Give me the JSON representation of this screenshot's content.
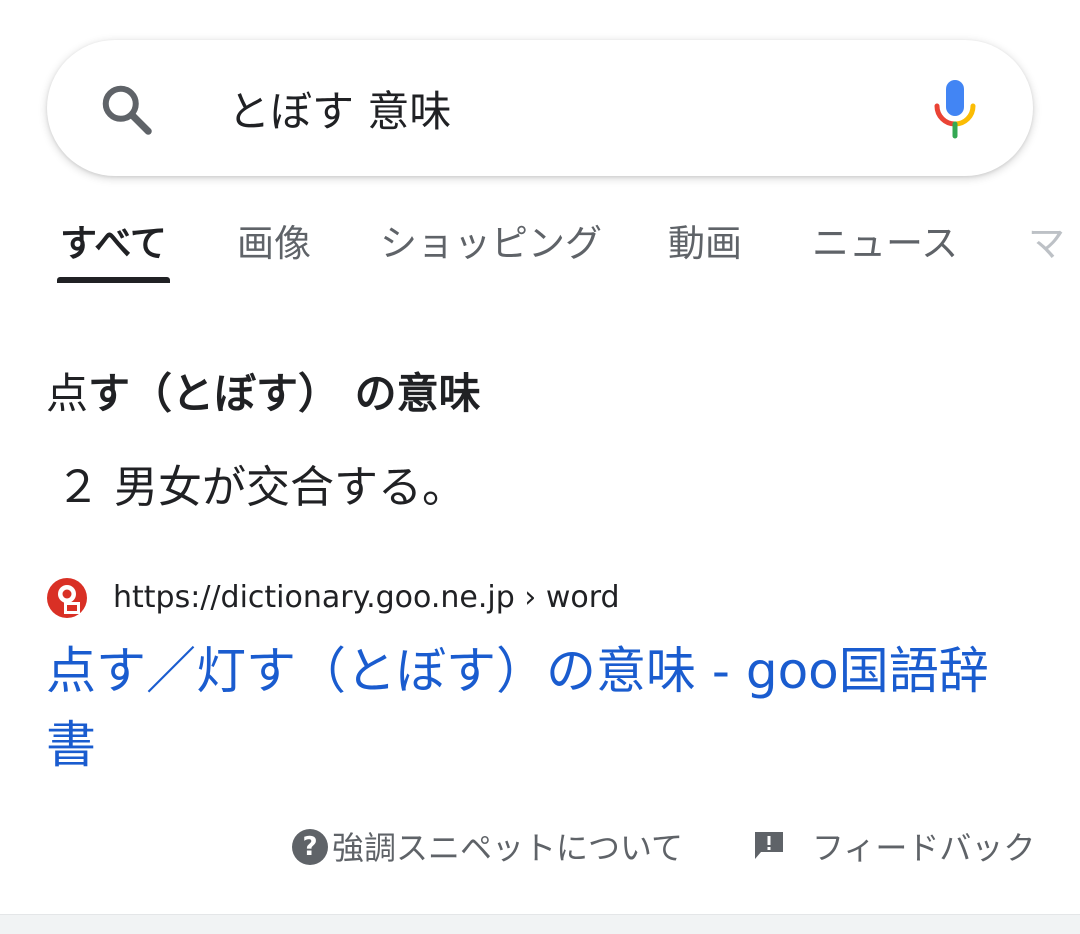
{
  "search": {
    "query": "とぼす 意味",
    "icon": "search-icon",
    "voice_icon": "mic-icon"
  },
  "tabs": [
    {
      "label": "すべて",
      "active": true
    },
    {
      "label": "画像",
      "active": false
    },
    {
      "label": "ショッピング",
      "active": false
    },
    {
      "label": "動画",
      "active": false
    },
    {
      "label": "ニュース",
      "active": false
    },
    {
      "label": "マ",
      "active": false
    }
  ],
  "snippet": {
    "heading_prefix": "点",
    "heading_bold": "す（とぼす） の意味",
    "definition": "２ 男女が交合する。",
    "source_url": "https://dictionary.goo.ne.jp › word",
    "result_title": "点す／灯す（とぼす）の意味 - goo国語辞書"
  },
  "footer": {
    "about_label": "強調スニペットについて",
    "feedback_label": "フィードバック"
  },
  "colors": {
    "link": "#1a5ccf",
    "text": "#202124",
    "secondary": "#5f6368",
    "mic_blue": "#4285f4",
    "mic_red": "#ea4335",
    "mic_yellow": "#fbbc04",
    "mic_green": "#34a853",
    "favicon_red": "#d93025"
  }
}
